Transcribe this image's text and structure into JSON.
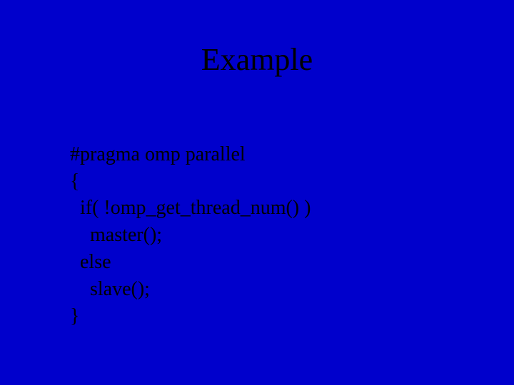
{
  "title": "Example",
  "code": {
    "l1": "#pragma omp parallel",
    "l2": "{",
    "l3": "  if( !omp_get_thread_num() )",
    "l4": "    master();",
    "l5": "  else",
    "l6": "    slave();",
    "l7": "}"
  }
}
